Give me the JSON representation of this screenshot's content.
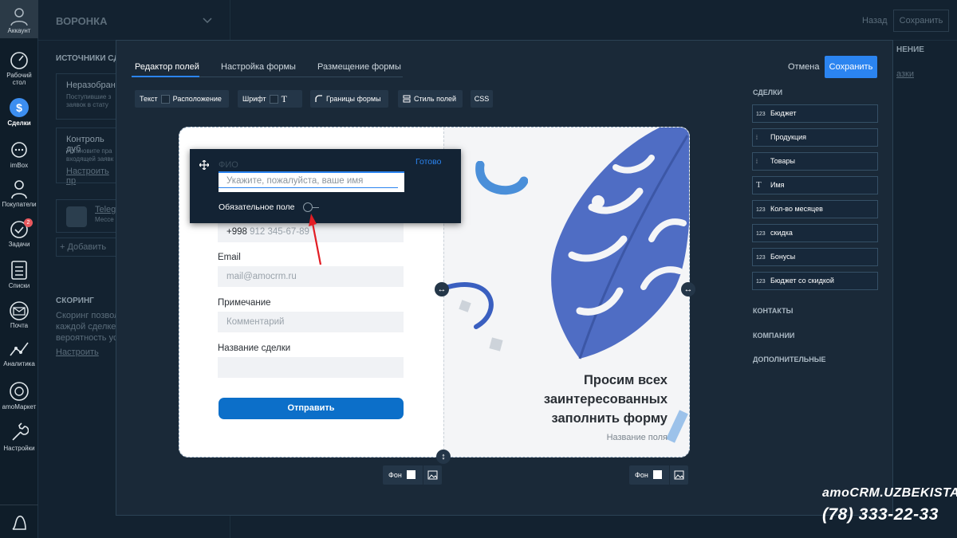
{
  "sidebar": {
    "items": [
      {
        "label": "Аккаунт"
      },
      {
        "label": "Рабочий стол"
      },
      {
        "label": "Сделки"
      },
      {
        "label": "imBox"
      },
      {
        "label": "Покупатели"
      },
      {
        "label": "Задачи",
        "badge": "2"
      },
      {
        "label": "Списки"
      },
      {
        "label": "Почта"
      },
      {
        "label": "Аналитика"
      },
      {
        "label": "amoМаркет"
      },
      {
        "label": "Настройки"
      }
    ]
  },
  "background": {
    "title": "ВОРОНКА",
    "back": "Назад",
    "save": "Сохранить",
    "sources_head": "ИСТОЧНИКИ СД",
    "unsorted_title": "Неразобранн",
    "unsorted_desc1": "Поступившие з",
    "unsorted_desc2": "заявок в стату",
    "dup_title": "Контроль дуб",
    "dup_desc1": "Установите пра",
    "dup_desc2": "входящей заявк",
    "dup_link": "Настроить пр",
    "telegram_title": "Teleg",
    "telegram_sub": "Мессе",
    "add": "+ Добавить",
    "scoring_head": "СКОРИНГ",
    "scoring_desc1": "Скоринг позвол",
    "scoring_desc2": "каждой сделке",
    "scoring_desc3": "вероятность ус",
    "scoring_link": "Настроить",
    "right_head": "НЕНИЕ",
    "right_link": "азки"
  },
  "modal": {
    "tabs": [
      "Редактор полей",
      "Настройка формы",
      "Размещение формы"
    ],
    "cancel": "Отмена",
    "save": "Сохранить",
    "toolbar": {
      "text": "Текст",
      "layout": "Расположение",
      "font": "Шрифт",
      "font_icon": "T",
      "borders": "Границы формы",
      "field_style": "Стиль полей",
      "css": "CSS"
    },
    "right_panel": {
      "deals_head": "СДЕЛКИ",
      "fields": [
        {
          "icon": "123",
          "label": "Бюджет"
        },
        {
          "icon": "⁞",
          "label": "Продукция"
        },
        {
          "icon": "⁞",
          "label": "Товары"
        },
        {
          "icon": "T",
          "label": "Имя"
        },
        {
          "icon": "123",
          "label": "Кол-во месяцев"
        },
        {
          "icon": "123",
          "label": "скидка"
        },
        {
          "icon": "123",
          "label": "Бонусы"
        },
        {
          "icon": "123",
          "label": "Бюджет со скидкой"
        }
      ],
      "contacts": "КОНТАКТЫ",
      "companies": "КОМПАНИИ",
      "additional": "ДОПОЛНИТЕЛЬНЫЕ"
    },
    "form": {
      "fio_label": "ФИО",
      "phone_prefix": "+998",
      "phone_placeholder": "912 345-67-89",
      "email_label": "Email",
      "email_placeholder": "mail@amocrm.ru",
      "note_label": "Примечание",
      "note_placeholder": "Комментарий",
      "deal_label": "Название сделки",
      "submit": "Отправить",
      "heading_line1": "Просим всех",
      "heading_line2": "заинтересованных",
      "heading_line3": "заполнить форму",
      "field_name": "Название поля",
      "bg_label": "Фон"
    },
    "popup": {
      "done": "Готово",
      "placeholder": "Укажите, пожалуйста, ваше имя",
      "required": "Обязательное поле"
    }
  },
  "watermark": {
    "brand": "amoCRM.UZBEKISTAN",
    "phone": "(78) 333-22-33"
  },
  "colors": {
    "accent": "#2b84f0",
    "submit": "#0c6fc9",
    "leaf": "#4f6dc4",
    "arrow": "#e21d24"
  }
}
